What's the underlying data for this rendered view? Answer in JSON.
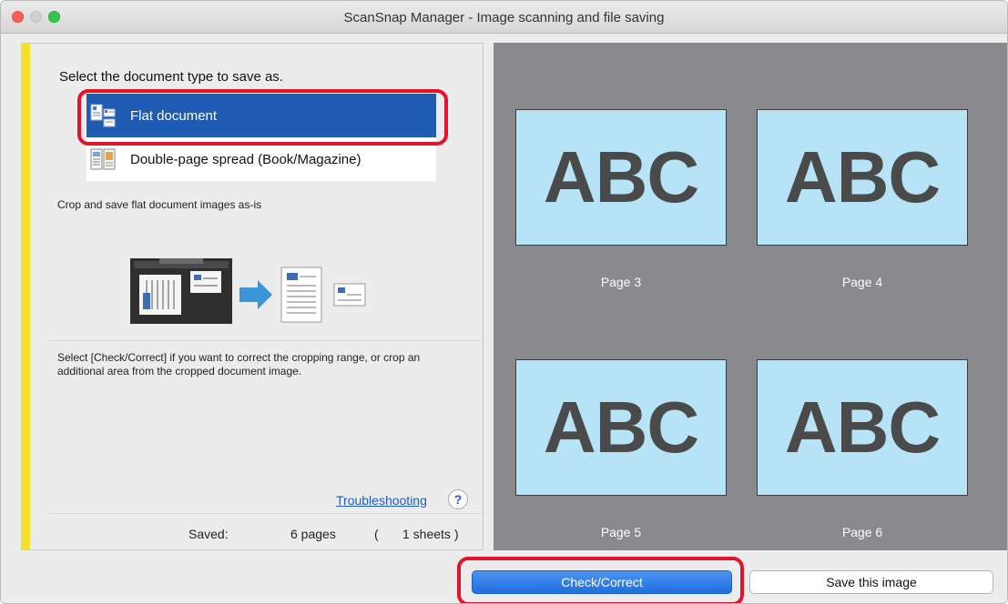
{
  "window": {
    "title": "ScanSnap Manager - Image scanning and file saving"
  },
  "left_panel": {
    "prompt": "Select the document type to save as.",
    "options": [
      {
        "label": "Flat document",
        "selected": true
      },
      {
        "label": "Double-page spread (Book/Magazine)",
        "selected": false
      }
    ],
    "description": "Crop and save flat document images as-is",
    "note": "Select [Check/Correct] if you want to correct the cropping range, or crop an additional area from the cropped document image.",
    "troubleshooting": "Troubleshooting",
    "help_glyph": "?",
    "saved": {
      "label": "Saved:",
      "pages": "6 pages",
      "open_paren": "(",
      "sheets": "1 sheets )"
    }
  },
  "preview": {
    "pages": [
      {
        "text": "ABC",
        "label": "Page 3"
      },
      {
        "text": "ABC",
        "label": "Page 4"
      },
      {
        "text": "ABC",
        "label": "Page 5"
      },
      {
        "text": "ABC",
        "label": "Page 6"
      }
    ]
  },
  "buttons": {
    "check_correct": "Check/Correct",
    "save_image": "Save this image"
  },
  "colors": {
    "selected_option": "#1f5bb3",
    "highlight": "#e3142a",
    "side_accent": "#f5de2c",
    "preview_bg": "#8a898d",
    "thumb_bg": "#b7e3f6",
    "primary_button": "#1f6fe0"
  },
  "icons": {
    "flat_option": "flat-document-icon",
    "spread_option": "book-spread-icon",
    "help": "help-icon"
  }
}
